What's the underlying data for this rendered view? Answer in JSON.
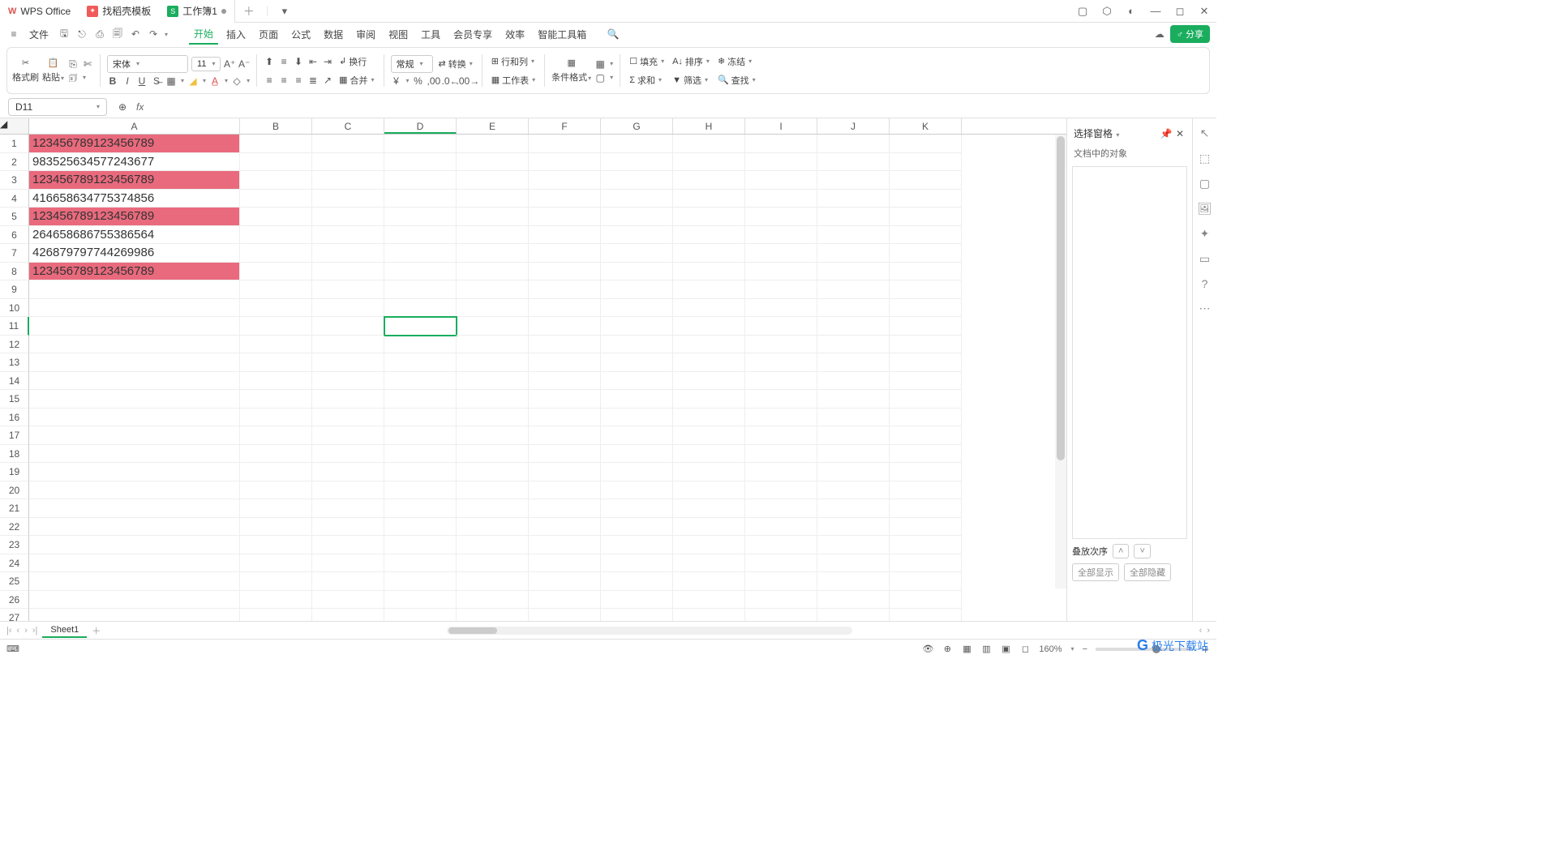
{
  "titleTabs": {
    "wps": "WPS Office",
    "template": "找稻壳模板",
    "workbook": "工作簿1"
  },
  "menu": {
    "file": "文件",
    "items": [
      "开始",
      "插入",
      "页面",
      "公式",
      "数据",
      "审阅",
      "视图",
      "工具",
      "会员专享",
      "效率",
      "智能工具箱"
    ],
    "share": "分享"
  },
  "ribbon": {
    "formatPainter": "格式刷",
    "paste": "粘贴",
    "fontName": "宋体",
    "fontSize": "11",
    "wrap": "换行",
    "merge": "合并",
    "numberFormat": "常规",
    "convert": "转换",
    "rowsCols": "行和列",
    "worksheet": "工作表",
    "condFormat": "条件格式",
    "fill": "填充",
    "sort": "排序",
    "freeze": "冻结",
    "sum": "求和",
    "filter": "筛选",
    "find": "查找"
  },
  "nameBox": "D11",
  "columns": [
    "A",
    "B",
    "C",
    "D",
    "E",
    "F",
    "G",
    "H",
    "I",
    "J",
    "K"
  ],
  "cells": [
    {
      "row": 1,
      "val": "123456789123456789",
      "hl": true
    },
    {
      "row": 2,
      "val": "983525634577243677",
      "hl": false
    },
    {
      "row": 3,
      "val": "123456789123456789",
      "hl": true
    },
    {
      "row": 4,
      "val": "416658634775374856",
      "hl": false
    },
    {
      "row": 5,
      "val": "123456789123456789",
      "hl": true
    },
    {
      "row": 6,
      "val": "264658686755386564",
      "hl": false
    },
    {
      "row": 7,
      "val": "426879797744269986",
      "hl": false
    },
    {
      "row": 8,
      "val": "123456789123456789",
      "hl": true
    }
  ],
  "selectedCell": {
    "col": "D",
    "row": 11
  },
  "rightPanel": {
    "title": "选择窗格",
    "sub": "文档中的对象",
    "stack": "叠放次序",
    "showAll": "全部显示",
    "hideAll": "全部隐藏"
  },
  "sheet": {
    "name": "Sheet1"
  },
  "status": {
    "zoom": "160%"
  },
  "watermark": "极光下载站"
}
